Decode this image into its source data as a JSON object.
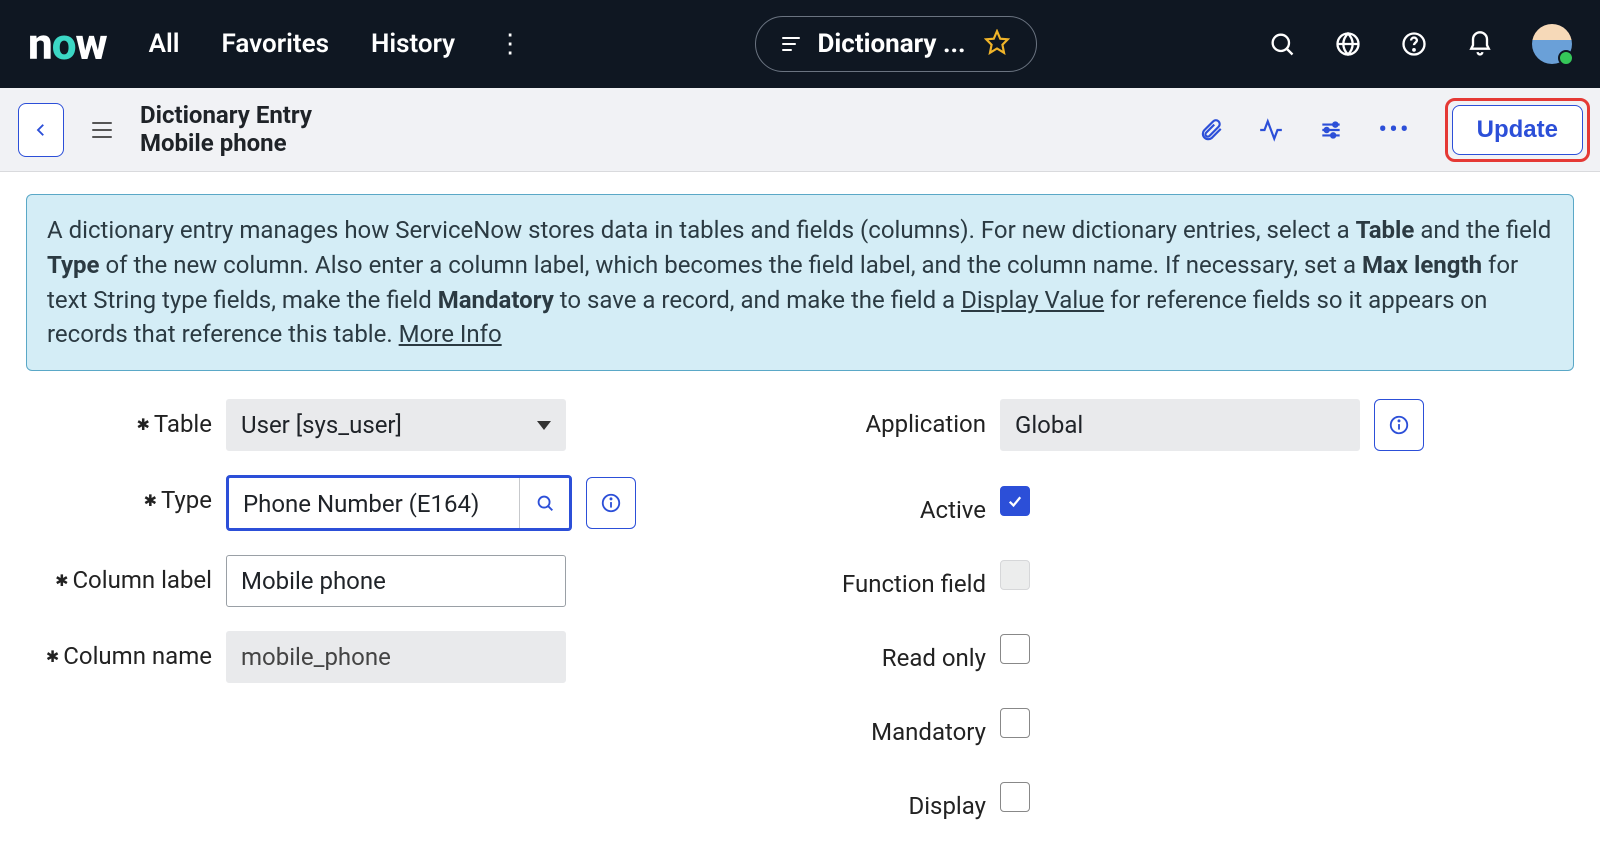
{
  "nav": {
    "logo_text": "now",
    "links": {
      "all": "All",
      "favorites": "Favorites",
      "history": "History"
    },
    "crumb_title": "Dictionary ..."
  },
  "subheader": {
    "title_line1": "Dictionary Entry",
    "title_line2": "Mobile phone",
    "update_label": "Update"
  },
  "banner": {
    "p1a": "A dictionary entry manages how ServiceNow stores data in tables and fields (columns). For new dictionary entries, select a ",
    "b1": "Table",
    "p1b": " and the field ",
    "b2": "Type",
    "p1c": " of the new column. Also enter a column label, which becomes the field label, and the column name. If necessary, set a ",
    "b3": "Max length",
    "p1d": " for text String type fields, make the field ",
    "b4": "Mandatory",
    "p1e": " to save a record, and make the field a ",
    "l1": "Display Value",
    "p1f": " for reference fields so it appears on records that reference this table. ",
    "l2": "More Info"
  },
  "form": {
    "labels": {
      "table": "Table",
      "type": "Type",
      "column_label": "Column label",
      "column_name": "Column name",
      "application": "Application",
      "active": "Active",
      "function_field": "Function field",
      "read_only": "Read only",
      "mandatory": "Mandatory",
      "display": "Display"
    },
    "values": {
      "table": "User [sys_user]",
      "type": "Phone Number (E164)",
      "column_label": "Mobile phone",
      "column_name": "mobile_phone",
      "application": "Global"
    },
    "checks": {
      "active": true,
      "function_field": false,
      "read_only": false,
      "mandatory": false,
      "display": false
    }
  }
}
